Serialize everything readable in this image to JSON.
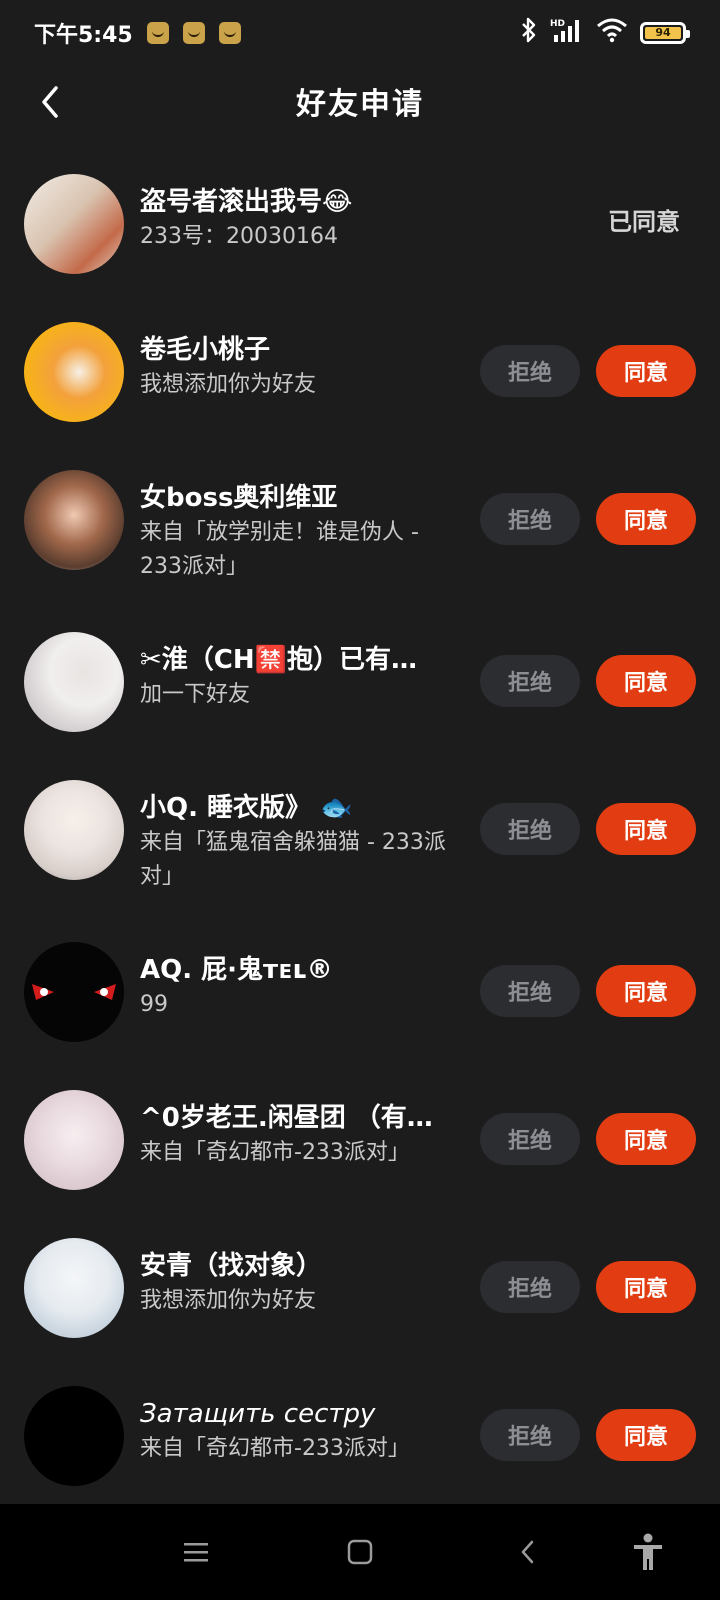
{
  "status_bar": {
    "time": "下午5:45",
    "battery_text": "94",
    "icons": [
      "app-notification-icon",
      "app-notification-icon",
      "app-notification-icon",
      "bluetooth-icon",
      "hd-signal-icon",
      "wifi-icon",
      "battery-icon"
    ]
  },
  "header": {
    "title": "好友申请",
    "back_icon": "chevron-left-icon"
  },
  "buttons": {
    "reject": "拒绝",
    "accept": "同意",
    "agreed": "已同意"
  },
  "requests": [
    {
      "name": "盗号者滚出我号😂",
      "sub": "233号：20030164",
      "status": "agreed"
    },
    {
      "name": "卷毛小桃子",
      "sub": "我想添加你为好友",
      "status": "pending"
    },
    {
      "name": "女boss奥利维亚",
      "sub": "来自「放学别走！谁是伪人 - 233派对」",
      "status": "pending"
    },
    {
      "name": "✂淮（CH🈲抱）已有…",
      "sub": "加一下好友",
      "status": "pending"
    },
    {
      "name": "小Q. 睡衣版》 🐟",
      "sub": "来自「猛鬼宿舍躲猫猫 - 233派对」",
      "status": "pending"
    },
    {
      "name": "AQ. 屁·鬼ᴛᴇʟ®",
      "sub": "99",
      "status": "pending"
    },
    {
      "name": "^0岁老王.闲昼团 （有…",
      "sub": "来自「奇幻都市-233派对」",
      "status": "pending"
    },
    {
      "name": "安青（找对象）",
      "sub": "我想添加你为好友",
      "status": "pending"
    },
    {
      "name": "Затащить сестру",
      "sub": "来自「奇幻都市-233派对」",
      "status": "pending"
    }
  ],
  "colors": {
    "background": "#1c1c1d",
    "accept": "#e23c12",
    "reject_bg": "#2c2d31",
    "reject_text": "#8d8e93"
  },
  "nav_bar": {
    "icons": [
      "menu-icon",
      "home-square-icon",
      "back-icon",
      "accessibility-icon"
    ]
  }
}
